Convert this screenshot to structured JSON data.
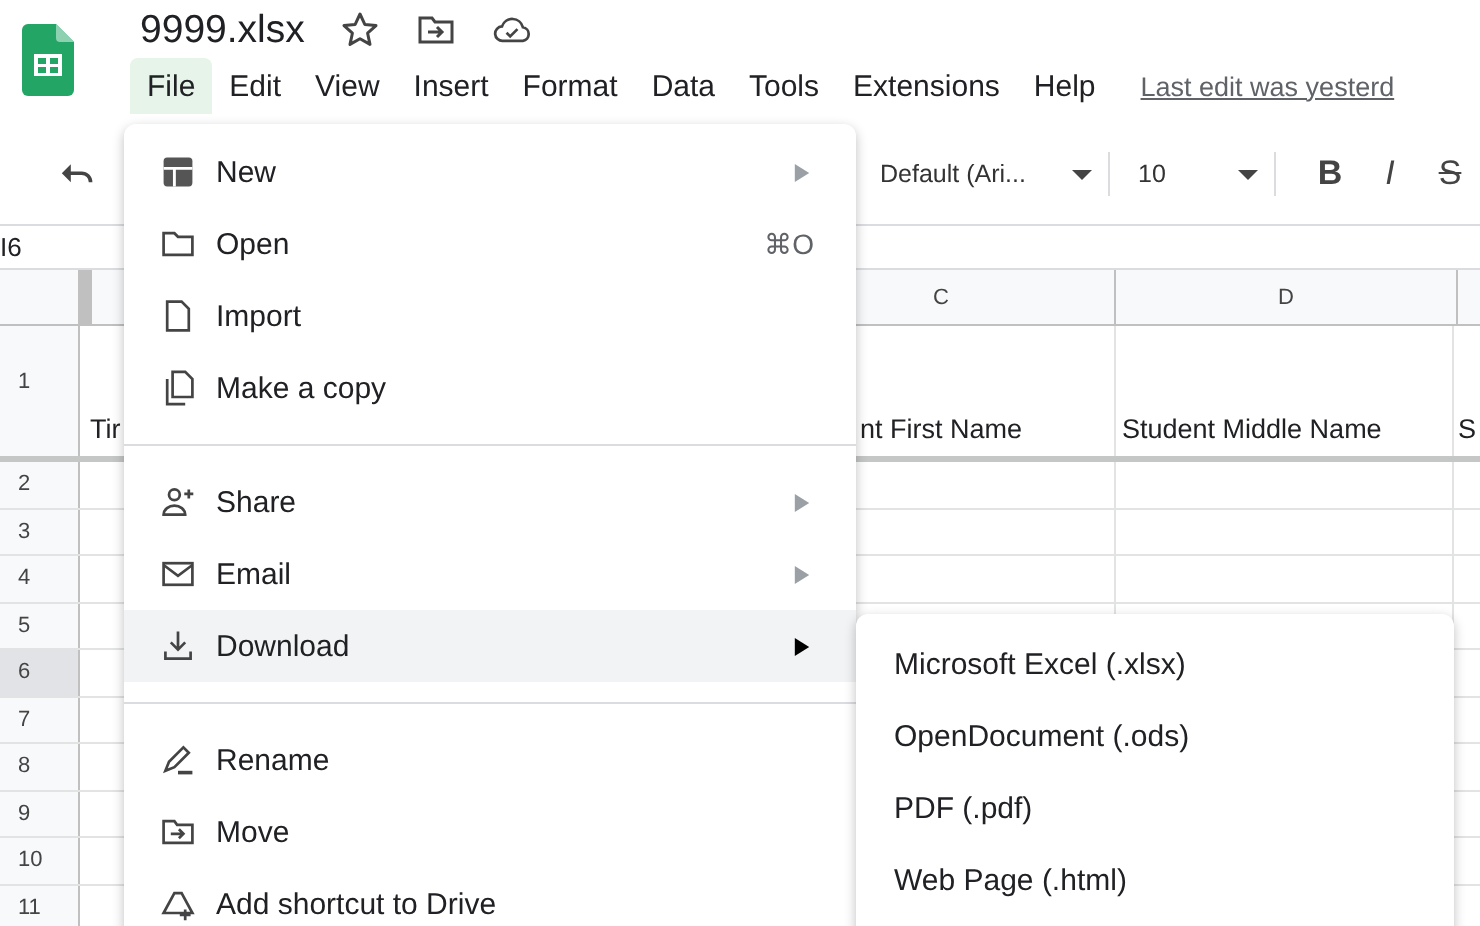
{
  "document": {
    "title": "9999.xlsx"
  },
  "menubar": {
    "items": [
      {
        "label": "File",
        "selected": true
      },
      {
        "label": "Edit",
        "selected": false
      },
      {
        "label": "View",
        "selected": false
      },
      {
        "label": "Insert",
        "selected": false
      },
      {
        "label": "Format",
        "selected": false
      },
      {
        "label": "Data",
        "selected": false
      },
      {
        "label": "Tools",
        "selected": false
      },
      {
        "label": "Extensions",
        "selected": false
      },
      {
        "label": "Help",
        "selected": false
      }
    ],
    "last_edit": "Last edit was yesterd"
  },
  "toolbar": {
    "font": "Default (Ari...",
    "font_size": "10",
    "format_buttons": [
      {
        "label": "B",
        "kind": "bold"
      },
      {
        "label": "I",
        "kind": "italic"
      },
      {
        "label": "S",
        "kind": "strike"
      }
    ]
  },
  "name_box": "I6",
  "sheet": {
    "column_headers": [
      "C",
      "D"
    ],
    "first_row": {
      "number": "1",
      "cells": [
        "Tir",
        "nt First Name",
        "Student Middle Name",
        "S"
      ]
    },
    "rows": [
      {
        "number": "2",
        "selected": false
      },
      {
        "number": "3",
        "selected": false
      },
      {
        "number": "4",
        "selected": false
      },
      {
        "number": "5",
        "selected": false
      },
      {
        "number": "6",
        "selected": true
      },
      {
        "number": "7",
        "selected": false
      },
      {
        "number": "8",
        "selected": false
      },
      {
        "number": "9",
        "selected": false
      },
      {
        "number": "10",
        "selected": false
      },
      {
        "number": "11",
        "selected": false
      }
    ]
  },
  "file_menu": {
    "items": [
      {
        "kind": "item",
        "label": "New",
        "submenu": true,
        "selected": false
      },
      {
        "kind": "item",
        "label": "Open",
        "shortcut": "⌘O",
        "submenu": false,
        "selected": false
      },
      {
        "kind": "item",
        "label": "Import",
        "submenu": false,
        "selected": false
      },
      {
        "kind": "item",
        "label": "Make a copy",
        "submenu": false,
        "selected": false
      },
      {
        "kind": "divider"
      },
      {
        "kind": "item",
        "label": "Share",
        "submenu": true,
        "selected": false
      },
      {
        "kind": "item",
        "label": "Email",
        "submenu": true,
        "selected": false
      },
      {
        "kind": "item",
        "label": "Download",
        "submenu": true,
        "selected": true
      },
      {
        "kind": "divider"
      },
      {
        "kind": "item",
        "label": "Rename",
        "submenu": false,
        "selected": false
      },
      {
        "kind": "item",
        "label": "Move",
        "submenu": false,
        "selected": false
      },
      {
        "kind": "item",
        "label": "Add shortcut to Drive",
        "submenu": false,
        "selected": false
      }
    ]
  },
  "download_submenu": {
    "items": [
      "Microsoft Excel (.xlsx)",
      "OpenDocument (.ods)",
      "PDF (.pdf)",
      "Web Page (.html)"
    ]
  }
}
